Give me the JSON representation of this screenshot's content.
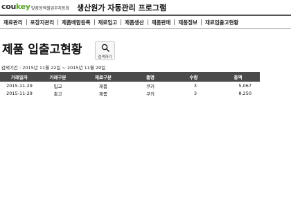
{
  "header": {
    "logo_prefix": "cou",
    "logo_key": "key",
    "tagline": "맞춤형엑셀업무자동화",
    "app_title": "생산원가 자동관리 프로그램"
  },
  "menu": [
    {
      "label": "재료관리"
    },
    {
      "label": "포장지관리"
    },
    {
      "label": "제품배합등록"
    },
    {
      "label": "재료입고"
    },
    {
      "label": "제품생산"
    },
    {
      "label": "제품판매"
    },
    {
      "label": "제품정보"
    },
    {
      "label": "재료입출고현황"
    }
  ],
  "page": {
    "title": "제품 입출고현황",
    "search_label": "검색하기",
    "search_icon": "magnifier-icon",
    "period_text": "검색기간 : 2015년 11월 22일 ~ 2015년 11월 29일"
  },
  "table": {
    "columns": [
      "거래일자",
      "거래구분",
      "재료구분",
      "품명",
      "수량",
      "총액"
    ],
    "rows": [
      [
        "2015-11-29",
        "입고",
        "제품",
        "쿠키",
        "3",
        "5,067"
      ],
      [
        "2015-11-29",
        "출고",
        "제품",
        "쿠키",
        "3",
        "8,250"
      ]
    ]
  },
  "colors": {
    "logo_key": "#5aa62a",
    "table_header_bg": "#4a4a4a",
    "table_header_text": "#ffffff"
  }
}
